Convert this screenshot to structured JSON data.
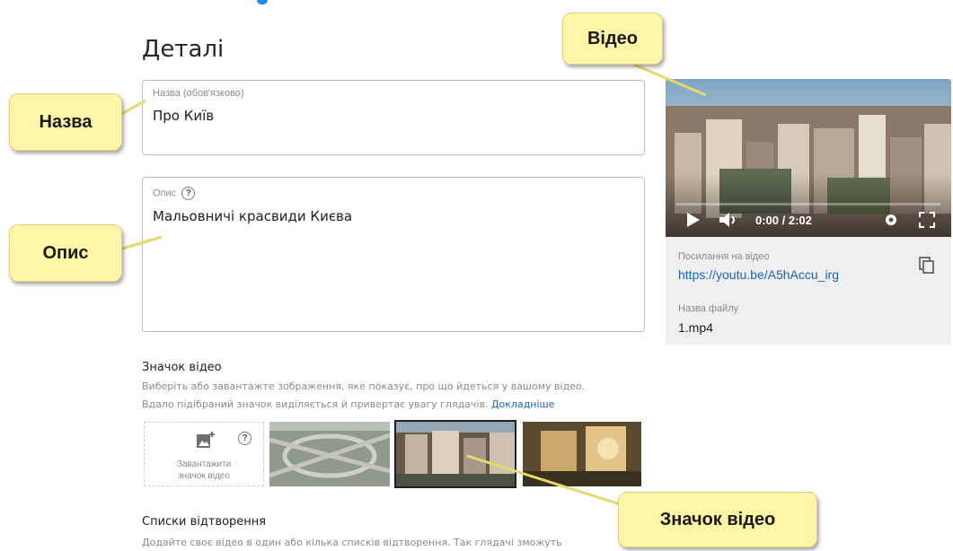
{
  "page": {
    "title": "Деталі"
  },
  "title_field": {
    "label": "Назва (обов'язково)",
    "value": "Про Київ"
  },
  "description_field": {
    "label": "Опис",
    "value": "Мальовничі красвиди Києва"
  },
  "video": {
    "time": "0:00 / 2:02",
    "link_label": "Посилання на відео",
    "link": "https://youtu.be/A5hAccu_irg",
    "filename_label": "Назва файлу",
    "filename": "1.mp4"
  },
  "thumbnail": {
    "heading": "Значок відео",
    "text_line1": "Виберіть або завантажте зображення, яке показує, про що йдеться у вашому відео.",
    "text_line2": "Вдало підібраний значок виділяється й привертає увагу глядачів.",
    "more_link": "Докладніше",
    "upload_label_line1": "Завантажити",
    "upload_label_line2": "значок відео"
  },
  "playlists": {
    "heading": "Списки відтворення",
    "text": "Додайте своє відео в один або кілька списків відтворення. Так глядачі зможуть"
  },
  "callouts": {
    "video": "Відео",
    "title": "Назва",
    "description": "Опис",
    "thumbnail": "Значок відео"
  },
  "icons": [
    "help-icon",
    "copy-icon",
    "add-photo-icon",
    "play-icon",
    "volume-icon",
    "settings-icon",
    "fullscreen-icon"
  ],
  "colors": {
    "link": "#1565c0",
    "callout": "#fdf6a8",
    "selected_border": "#202020"
  }
}
